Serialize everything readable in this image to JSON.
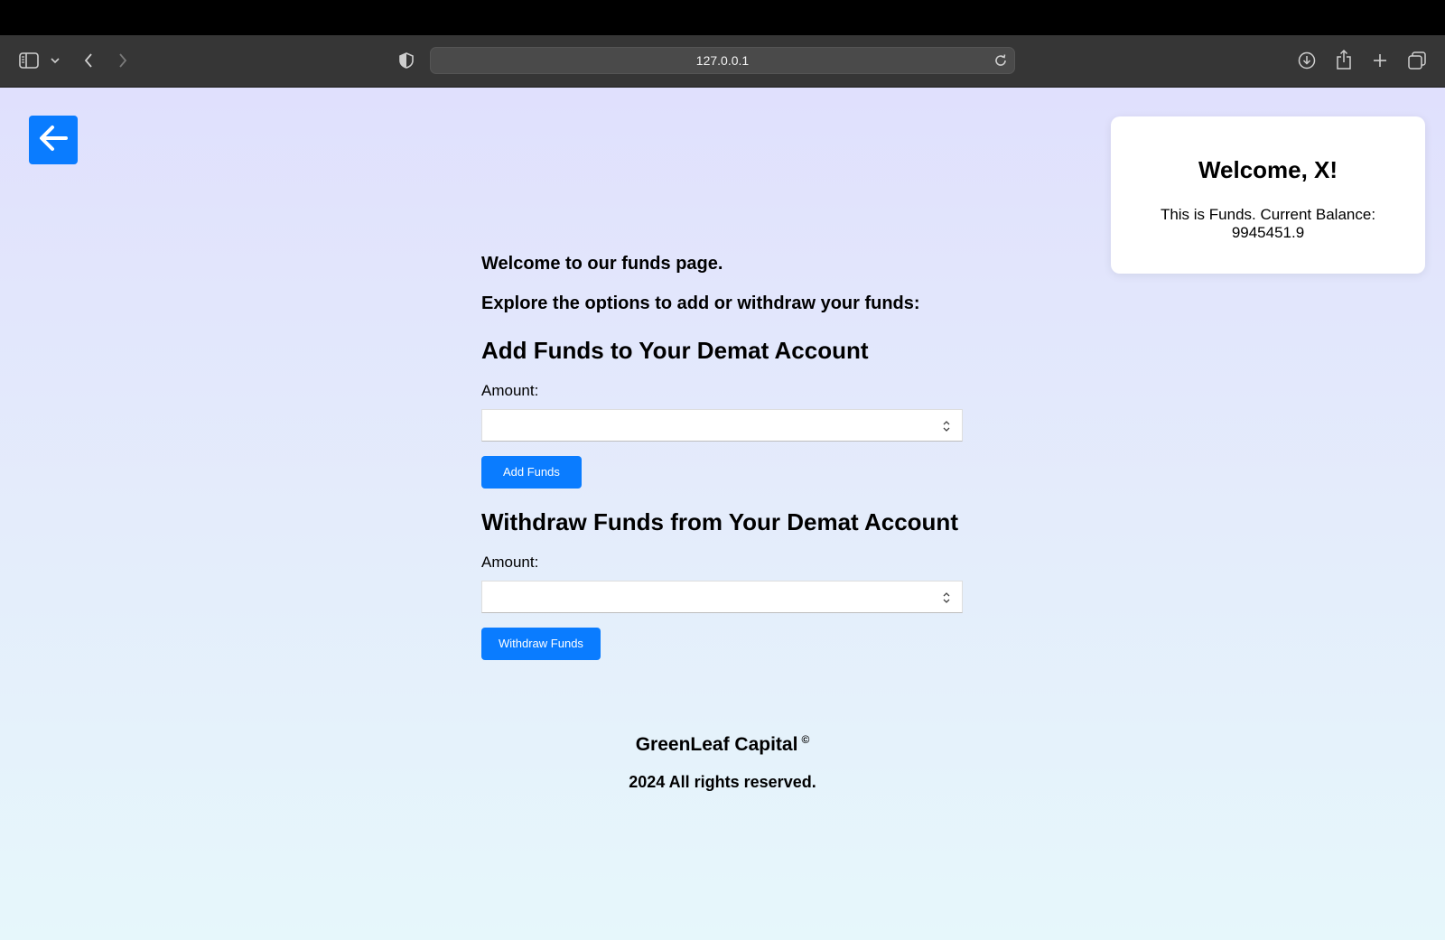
{
  "browser": {
    "url": "127.0.0.1"
  },
  "welcome_card": {
    "title": "Welcome, X!",
    "message": "This is Funds. Current Balance: 9945451.9"
  },
  "main": {
    "intro_1": "Welcome to our funds page.",
    "intro_2": "Explore the options to add or withdraw your funds:",
    "add_section": {
      "title": "Add Funds to Your Demat Account",
      "amount_label": "Amount:",
      "amount_value": "",
      "button_label": "Add Funds"
    },
    "withdraw_section": {
      "title": "Withdraw Funds from Your Demat Account",
      "amount_label": "Amount:",
      "amount_value": "",
      "button_label": "Withdraw Funds"
    }
  },
  "footer": {
    "brand": "GreenLeaf Capital",
    "copyright_symbol": "©",
    "rights": "2024 All rights reserved."
  },
  "colors": {
    "accent": "#0a7cff",
    "page_gradient_top": "#e0e0fd",
    "page_gradient_bottom": "#e6f7fb",
    "toolbar": "#363636"
  },
  "icons": {
    "sidebar_toggle": "sidebar-icon",
    "back_nav": "chevron-left-icon",
    "forward_nav": "chevron-right-icon",
    "privacy": "shield-icon",
    "reload": "reload-icon",
    "download": "download-icon",
    "share": "share-icon",
    "new_tab": "plus-icon",
    "tabs": "tabs-overview-icon",
    "page_back": "arrow-left-icon"
  }
}
